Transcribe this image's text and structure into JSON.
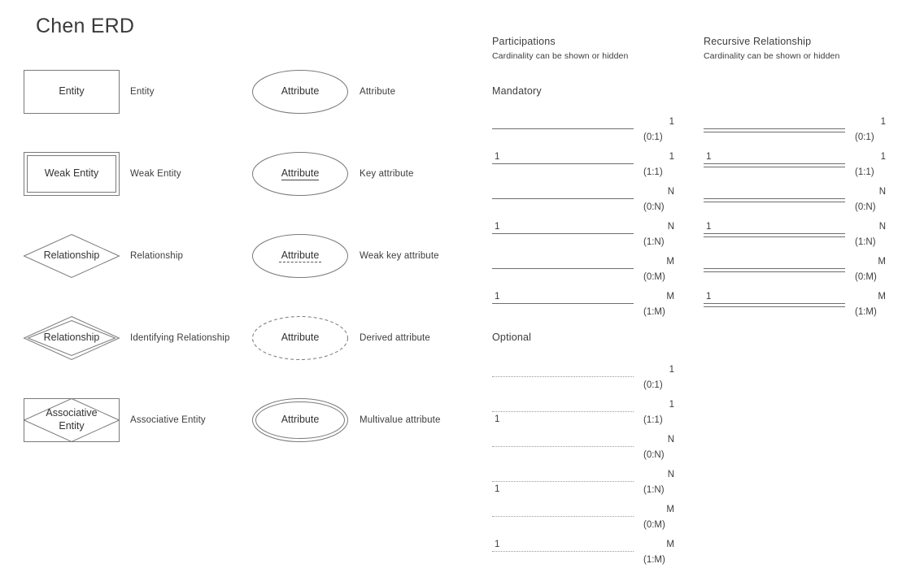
{
  "page": {
    "title": "Chen ERD"
  },
  "shapes_column_left": [
    {
      "shape": "rectangle",
      "shape_label": "Entity",
      "caption": "Entity"
    },
    {
      "shape": "double-rectangle",
      "shape_label": "Weak Entity",
      "caption": "Weak Entity"
    },
    {
      "shape": "diamond",
      "shape_label": "Relationship",
      "caption": "Relationship"
    },
    {
      "shape": "double-diamond",
      "shape_label": "Relationship",
      "caption": "Identifying Relationship"
    },
    {
      "shape": "rectangle-diamond",
      "shape_label": "Associative\nEntity",
      "caption": "Associative Entity"
    }
  ],
  "shapes_column_right": [
    {
      "shape": "ellipse",
      "shape_label": "Attribute",
      "underline": "none",
      "caption": "Attribute"
    },
    {
      "shape": "ellipse",
      "shape_label": "Attribute",
      "underline": "solid",
      "caption": "Key attribute"
    },
    {
      "shape": "ellipse",
      "shape_label": "Attribute",
      "underline": "dashed",
      "caption": "Weak key attribute"
    },
    {
      "shape": "dashed-ellipse",
      "shape_label": "Attribute",
      "underline": "none",
      "caption": "Derived attribute"
    },
    {
      "shape": "double-ellipse",
      "shape_label": "Attribute",
      "underline": "none",
      "caption": "Multivalue attribute"
    }
  ],
  "participations": {
    "title": "Participations",
    "subtitle": "Cardinality can be shown or hidden",
    "mandatory": {
      "title": "Mandatory",
      "rows": [
        {
          "left": "",
          "right": "1",
          "tag": "(0:1)",
          "left_below": false
        },
        {
          "left": "1",
          "right": "1",
          "tag": "(1:1)",
          "left_below": false
        },
        {
          "left": "",
          "right": "N",
          "tag": "(0:N)",
          "left_below": false
        },
        {
          "left": "1",
          "right": "N",
          "tag": "(1:N)",
          "left_below": false
        },
        {
          "left": "",
          "right": "M",
          "tag": "(0:M)",
          "left_below": false
        },
        {
          "left": "1",
          "right": "M",
          "tag": "(1:M)",
          "left_below": false
        }
      ]
    },
    "optional": {
      "title": "Optional",
      "rows": [
        {
          "left": "",
          "right": "1",
          "tag": "(0:1)",
          "left_below": false
        },
        {
          "left": "1",
          "right": "1",
          "tag": "(1:1)",
          "left_below": true
        },
        {
          "left": "",
          "right": "N",
          "tag": "(0:N)",
          "left_below": false
        },
        {
          "left": "1",
          "right": "N",
          "tag": "(1:N)",
          "left_below": true
        },
        {
          "left": "",
          "right": "M",
          "tag": "(0:M)",
          "left_below": false
        },
        {
          "left": "1",
          "right": "M",
          "tag": "(1:M)",
          "left_below": false
        }
      ]
    }
  },
  "recursive": {
    "title": "Recursive Relationship",
    "subtitle": "Cardinality can be shown or hidden",
    "rows": [
      {
        "left": "",
        "right": "1",
        "tag": "(0:1)"
      },
      {
        "left": "1",
        "right": "1",
        "tag": "(1:1)"
      },
      {
        "left": "",
        "right": "N",
        "tag": "(0:N)"
      },
      {
        "left": "1",
        "right": "N",
        "tag": "(1:N)"
      },
      {
        "left": "",
        "right": "M",
        "tag": "(0:M)"
      },
      {
        "left": "1",
        "right": "M",
        "tag": "(1:M)"
      }
    ]
  },
  "colors": {
    "stroke": "#7a7a7a",
    "text": "#3c3c3c",
    "background": "#ffffff"
  }
}
